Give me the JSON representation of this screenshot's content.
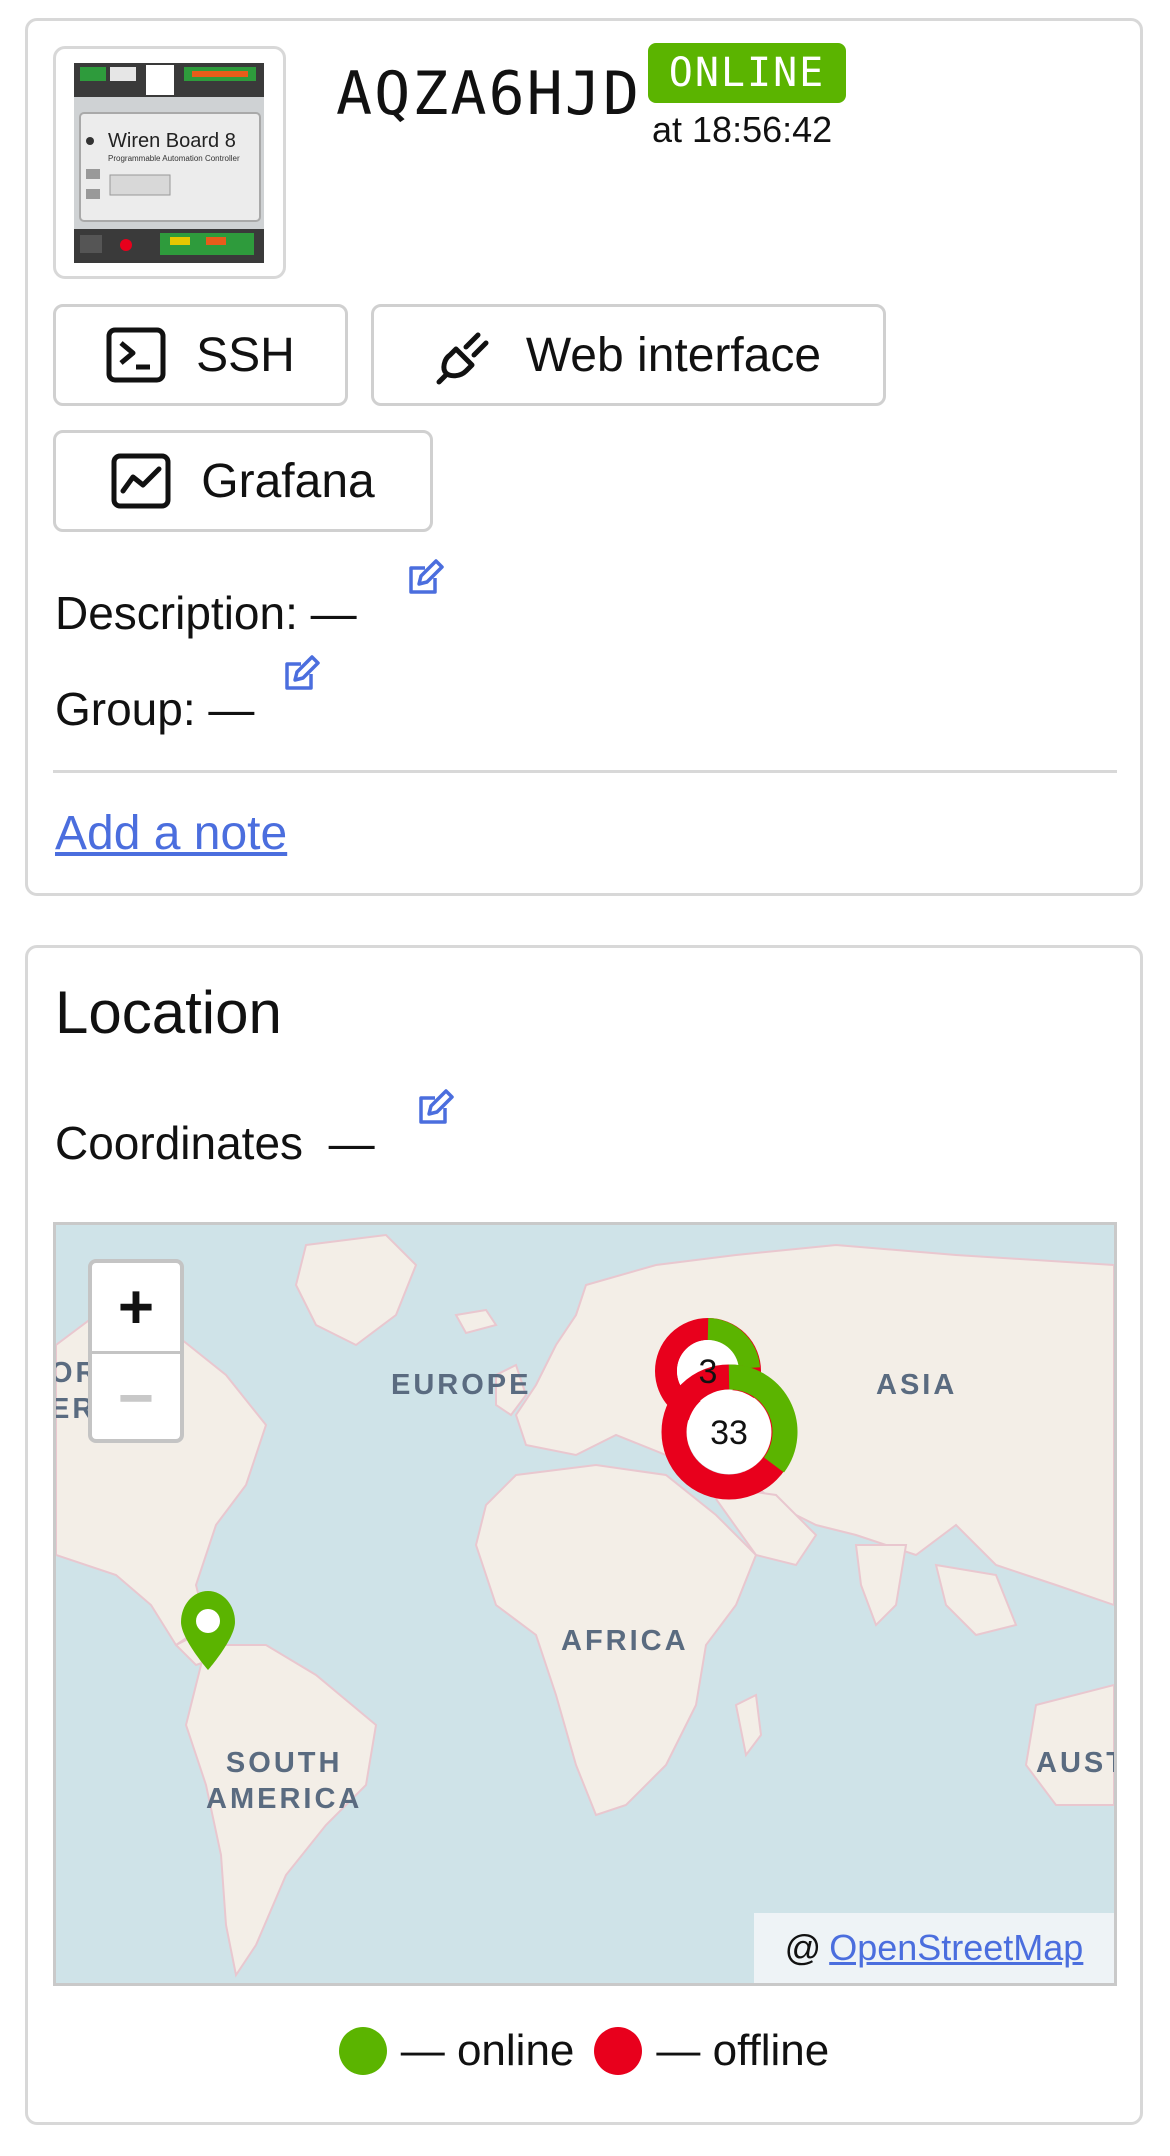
{
  "device": {
    "id": "AQZA6HJD",
    "status": "ONLINE",
    "status_time": "at 18:56:42",
    "status_color": "#5bb400",
    "image": {
      "title": "Wiren Board 8",
      "subtitle": "Programmable Automation Controller"
    }
  },
  "buttons": {
    "ssh": {
      "label": "SSH",
      "icon": "terminal-icon"
    },
    "web": {
      "label": "Web interface",
      "icon": "plug-icon"
    },
    "grafana": {
      "label": "Grafana",
      "icon": "chart-icon"
    }
  },
  "fields": {
    "description": {
      "label": "Description:",
      "value": "—"
    },
    "group": {
      "label": "Group:",
      "value": "—"
    }
  },
  "add_note": "Add a note",
  "location": {
    "title": "Location",
    "coordinates_label": "Coordinates",
    "coordinates_value": "—"
  },
  "map": {
    "zoom_in": "+",
    "zoom_out": "−",
    "regions": {
      "north_america": "OR\nERICA",
      "europe": "EUROPE",
      "asia": "ASIA",
      "africa": "AFRICA",
      "south_america": "SOUTH\nAMERICA",
      "australia": "AUST"
    },
    "clusters": [
      {
        "count": "3",
        "online_fraction": 0.4
      },
      {
        "count": "33",
        "online_fraction": 0.4
      }
    ],
    "attribution_prefix": "@",
    "attribution_link": "OpenStreetMap"
  },
  "legend": {
    "online": {
      "label": "— online",
      "color": "#5bb400"
    },
    "offline": {
      "label": "— offline",
      "color": "#e8001c"
    }
  }
}
